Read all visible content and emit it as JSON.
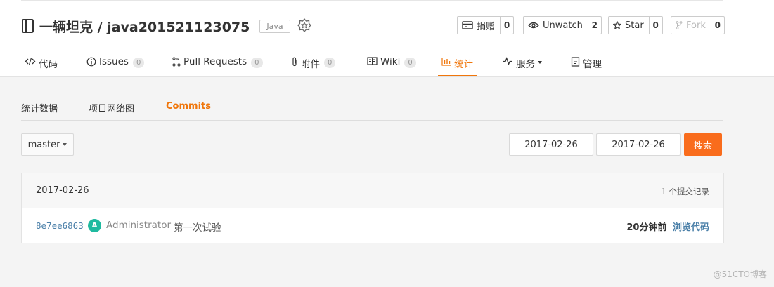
{
  "repo": {
    "title": "一辆坦克 / java201521123075",
    "language": "Java"
  },
  "actions": {
    "donate": {
      "label": "捐赠",
      "count": "0"
    },
    "unwatch": {
      "label": "Unwatch",
      "count": "2"
    },
    "star": {
      "label": "Star",
      "count": "0"
    },
    "fork": {
      "label": "Fork",
      "count": "0"
    }
  },
  "tabs": [
    {
      "label": "代码"
    },
    {
      "label": "Issues",
      "count": "0"
    },
    {
      "label": "Pull Requests",
      "count": "0"
    },
    {
      "label": "附件",
      "count": "0"
    },
    {
      "label": "Wiki",
      "count": "0"
    },
    {
      "label": "统计"
    },
    {
      "label": "服务"
    },
    {
      "label": "管理"
    }
  ],
  "subtabs": [
    {
      "label": "统计数据"
    },
    {
      "label": "项目网络图"
    },
    {
      "label": "Commits"
    }
  ],
  "filters": {
    "branch": "master",
    "start_date": "2017-02-26",
    "end_date": "2017-02-26",
    "search_label": "搜索"
  },
  "commits": {
    "date": "2017-02-26",
    "count_text": "1 个提交记录",
    "rows": [
      {
        "sha": "8e7ee6863",
        "avatar_letter": "A",
        "author": "Administrator",
        "message": "第一次试验",
        "time": "20分钟前",
        "browse": "浏览代码"
      }
    ]
  },
  "watermark": "@51CTO博客",
  "colors": {
    "accent": "#f0760b",
    "search_btn": "#f96c1c",
    "link": "#4a7fa8",
    "avatar": "#1fbaa0"
  }
}
